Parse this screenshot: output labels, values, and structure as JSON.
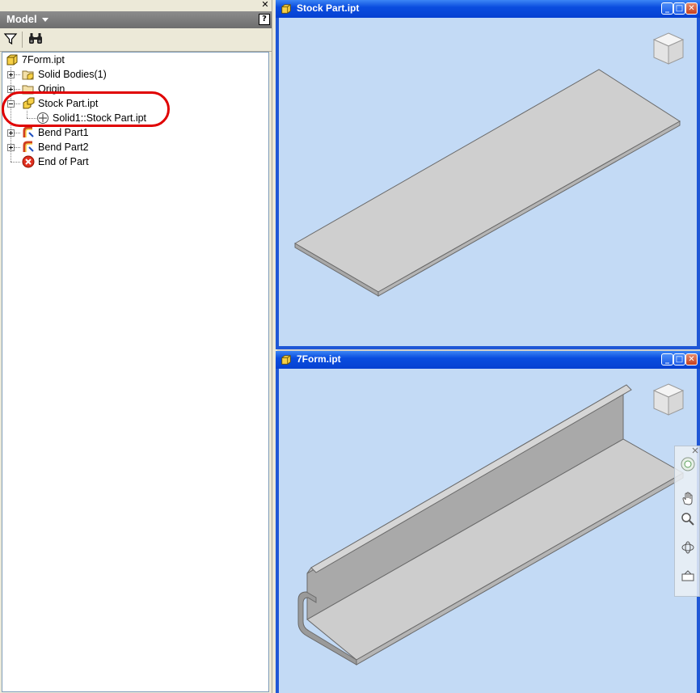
{
  "panel": {
    "title": "Model",
    "help_label": "?",
    "close_glyph": "✕"
  },
  "tree": [
    {
      "label": "7Form.ipt",
      "icon": "part-icon"
    },
    {
      "label": "Solid Bodies(1)",
      "icon": "solid-bodies-folder-icon"
    },
    {
      "label": "Origin",
      "icon": "folder-icon"
    },
    {
      "label": "Stock Part.ipt",
      "icon": "derived-part-icon"
    },
    {
      "label": "Solid1::Stock Part.ipt",
      "icon": "solid-body-icon"
    },
    {
      "label": "Bend Part1",
      "icon": "bend-part-icon"
    },
    {
      "label": "Bend Part2",
      "icon": "bend-part-icon"
    },
    {
      "label": "End of Part",
      "icon": "end-of-part-icon"
    }
  ],
  "windows": [
    {
      "title": "Stock Part.ipt"
    },
    {
      "title": "7Form.ipt"
    }
  ],
  "colors": {
    "titlebar": "#0a4ddf",
    "viewport_bg": "#c3daf5",
    "highlight": "#e00000",
    "part_gray": "#c8c8c8"
  }
}
